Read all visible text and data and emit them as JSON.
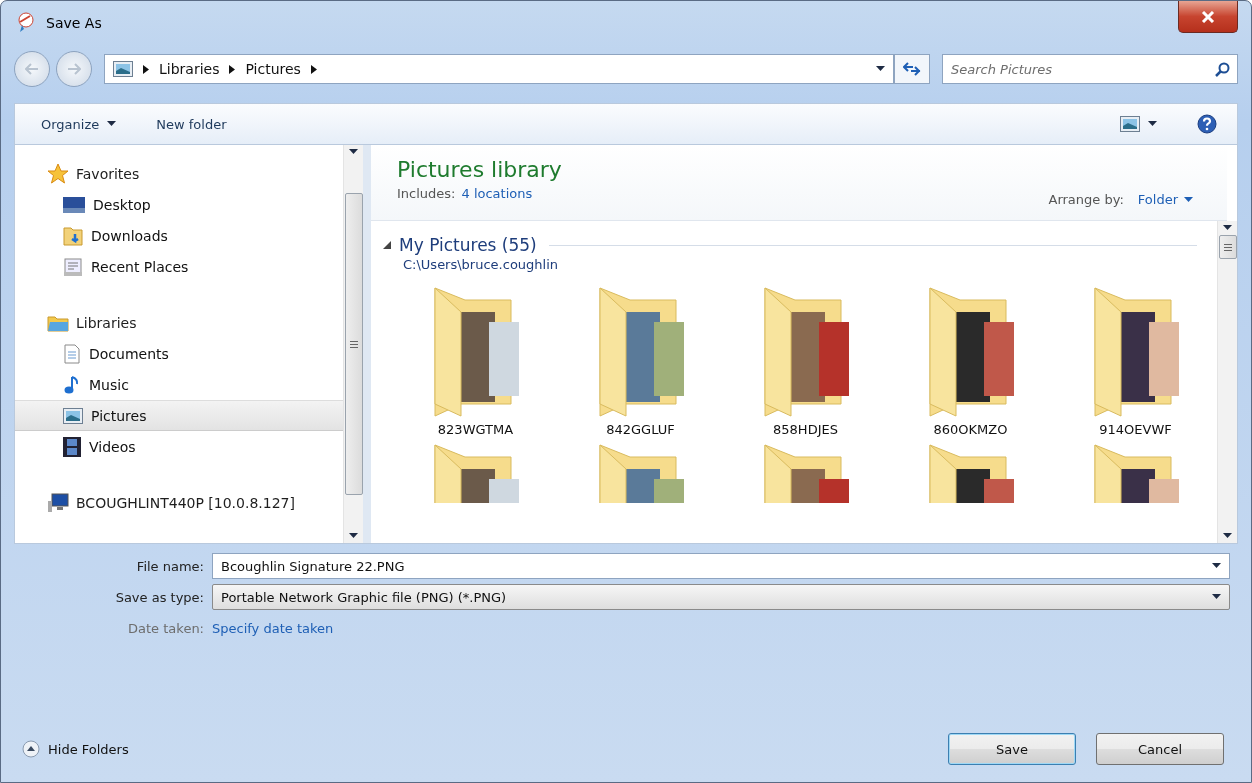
{
  "window": {
    "title": "Save As"
  },
  "address": {
    "crumbs": [
      "Libraries",
      "Pictures"
    ],
    "search_placeholder": "Search Pictures"
  },
  "toolbar": {
    "organize": "Organize",
    "new_folder": "New folder"
  },
  "nav": [
    {
      "label": "Favorites",
      "children": [
        {
          "label": "Desktop",
          "selected": false
        },
        {
          "label": "Downloads",
          "selected": false
        },
        {
          "label": "Recent Places",
          "selected": false
        }
      ]
    },
    {
      "label": "Libraries",
      "children": [
        {
          "label": "Documents",
          "selected": false
        },
        {
          "label": "Music",
          "selected": false
        },
        {
          "label": "Pictures",
          "selected": true
        },
        {
          "label": "Videos",
          "selected": false
        }
      ]
    },
    {
      "label": "BCOUGHLINT440P [10.0.8.127]"
    }
  ],
  "library": {
    "title": "Pictures library",
    "includes_label": "Includes:",
    "includes_link": "4 locations",
    "arrange_label": "Arrange by:",
    "arrange_value": "Folder"
  },
  "group": {
    "title": "My Pictures (55)",
    "path": "C:\\Users\\bruce.coughlin",
    "expanded": true
  },
  "folders": [
    {
      "name": "823WGTMA",
      "partial": false
    },
    {
      "name": "842GGLUF",
      "partial": false
    },
    {
      "name": "858HDJES",
      "partial": false
    },
    {
      "name": "860OKMZO",
      "partial": false
    },
    {
      "name": "914OEVWF",
      "partial": false
    },
    {
      "partial": true
    },
    {
      "partial": true
    },
    {
      "partial": true
    },
    {
      "partial": true
    },
    {
      "partial": true
    }
  ],
  "form": {
    "file_name_label": "File name:",
    "file_name": "Bcoughlin Signature 22.PNG",
    "type_label": "Save as type:",
    "type_value": "Portable Network Graphic file (PNG) (*.PNG)",
    "date_label": "Date taken:",
    "date_link": "Specify date taken"
  },
  "footer": {
    "hide_folders": "Hide Folders",
    "save": "Save",
    "cancel": "Cancel"
  }
}
